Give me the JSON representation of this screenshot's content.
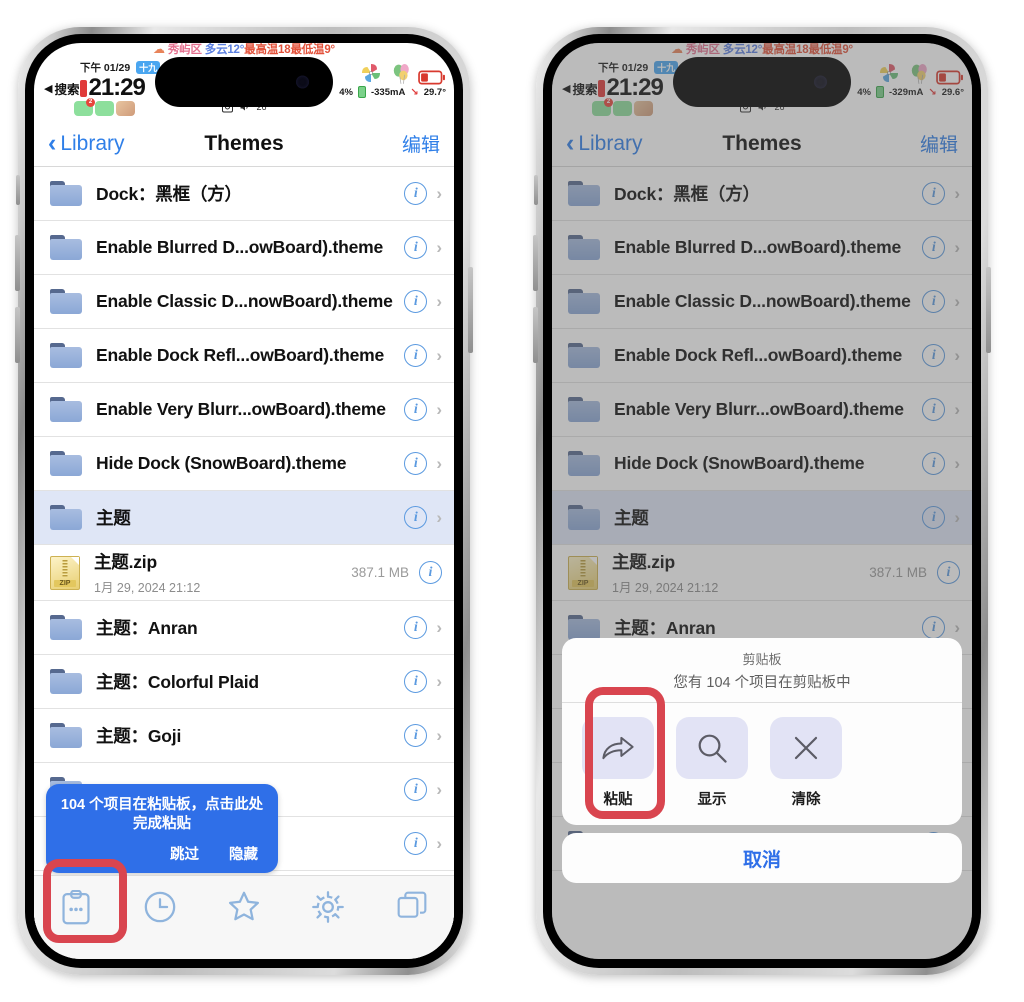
{
  "status_bar": {
    "weather": {
      "cloud_icon": "cloud-icon",
      "location": "秀屿区",
      "condition": "多云12°",
      "high_label": "最高温18",
      "low_label": "最低温9°"
    },
    "period": "下午",
    "date": "01/29",
    "lunar": "十九",
    "back_label": "搜索",
    "time": "21:29",
    "badge_count": "2",
    "volume": "26",
    "battery_percent_left": "4%",
    "current_left": "-335mA",
    "temperature_left": "29.7°",
    "battery_percent_right": "4%",
    "current_right": "-329mA",
    "temperature_right": "29.6°"
  },
  "navbar": {
    "back_label": "Library",
    "title": "Themes",
    "edit_label": "编辑"
  },
  "list": {
    "rows": [
      {
        "type": "folder",
        "label": "Dock：黑框（方）"
      },
      {
        "type": "folder",
        "label": "Enable Blurred D...owBoard).theme"
      },
      {
        "type": "folder",
        "label": "Enable Classic D...nowBoard).theme"
      },
      {
        "type": "folder",
        "label": "Enable Dock Refl...owBoard).theme"
      },
      {
        "type": "folder",
        "label": "Enable Very Blurr...owBoard).theme"
      },
      {
        "type": "folder",
        "label": "Hide Dock (SnowBoard).theme"
      },
      {
        "type": "folder",
        "label": "主题",
        "selected": true
      },
      {
        "type": "zip",
        "label": "主题.zip",
        "sub": "1月 29, 2024 21:12",
        "size": "387.1 MB"
      },
      {
        "type": "folder",
        "label": "主题：Anran"
      },
      {
        "type": "folder",
        "label": "主题：Colorful Plaid"
      },
      {
        "type": "folder",
        "label": "主题：Goji"
      },
      {
        "type": "folder",
        "label": ""
      },
      {
        "type": "folder",
        "label": ""
      },
      {
        "type": "folder",
        "label": ""
      }
    ]
  },
  "paste_tooltip": {
    "message": "104 个项目在粘贴板，点击此处完成粘贴",
    "skip_label": "跳过",
    "hide_label": "隐藏"
  },
  "tabbar": {
    "items": [
      {
        "icon": "clipboard-icon",
        "name": "clipboard"
      },
      {
        "icon": "clock-icon",
        "name": "recents"
      },
      {
        "icon": "star-icon",
        "name": "favorites"
      },
      {
        "icon": "gear-icon",
        "name": "settings"
      },
      {
        "icon": "windows-icon",
        "name": "tabs"
      }
    ]
  },
  "action_sheet": {
    "title": "剪贴板",
    "subtitle": "您有 104 个项目在剪贴板中",
    "actions": [
      {
        "icon": "share-arrow-icon",
        "label": "粘贴"
      },
      {
        "icon": "magnifier-icon",
        "label": "显示"
      },
      {
        "icon": "x-close-icon",
        "label": "清除"
      }
    ],
    "cancel_label": "取消"
  },
  "colors": {
    "accent_blue": "#2f7fe8",
    "highlight_red": "#d9454f",
    "tooltip_blue": "#2f6fe8",
    "selected_row": "#dfe6f6",
    "folder_blue": "#8ba8d6"
  }
}
